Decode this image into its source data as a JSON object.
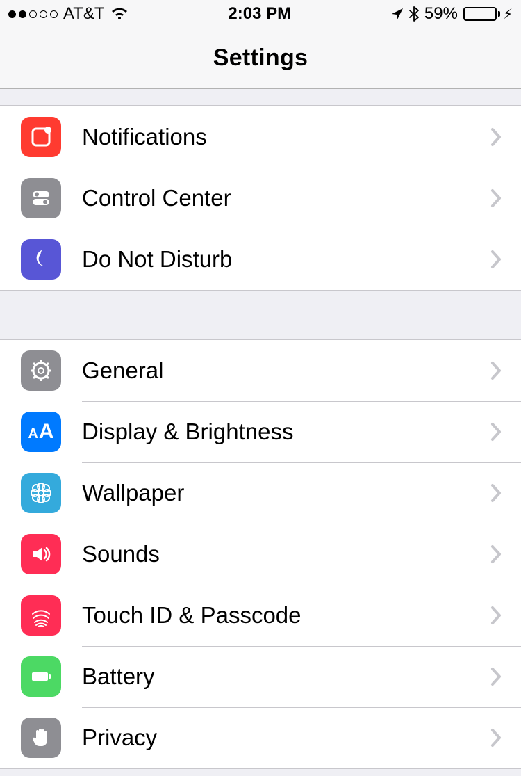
{
  "status": {
    "carrier": "AT&T",
    "time": "2:03 PM",
    "battery_pct": "59%"
  },
  "nav": {
    "title": "Settings"
  },
  "groups": [
    {
      "items": [
        {
          "id": "notifications",
          "label": "Notifications",
          "icon": "notifications-icon",
          "color": "bg-red"
        },
        {
          "id": "control-center",
          "label": "Control Center",
          "icon": "control-center-icon",
          "color": "bg-gray"
        },
        {
          "id": "do-not-disturb",
          "label": "Do Not Disturb",
          "icon": "moon-icon",
          "color": "bg-purple"
        }
      ]
    },
    {
      "items": [
        {
          "id": "general",
          "label": "General",
          "icon": "gear-icon",
          "color": "bg-gray"
        },
        {
          "id": "display-brightness",
          "label": "Display & Brightness",
          "icon": "text-size-icon",
          "color": "bg-blue"
        },
        {
          "id": "wallpaper",
          "label": "Wallpaper",
          "icon": "flower-icon",
          "color": "bg-cyan"
        },
        {
          "id": "sounds",
          "label": "Sounds",
          "icon": "speaker-icon",
          "color": "bg-pink"
        },
        {
          "id": "touch-id-passcode",
          "label": "Touch ID & Passcode",
          "icon": "fingerprint-icon",
          "color": "bg-pink"
        },
        {
          "id": "battery",
          "label": "Battery",
          "icon": "battery-icon",
          "color": "bg-green"
        },
        {
          "id": "privacy",
          "label": "Privacy",
          "icon": "hand-icon",
          "color": "bg-gray"
        }
      ]
    }
  ]
}
